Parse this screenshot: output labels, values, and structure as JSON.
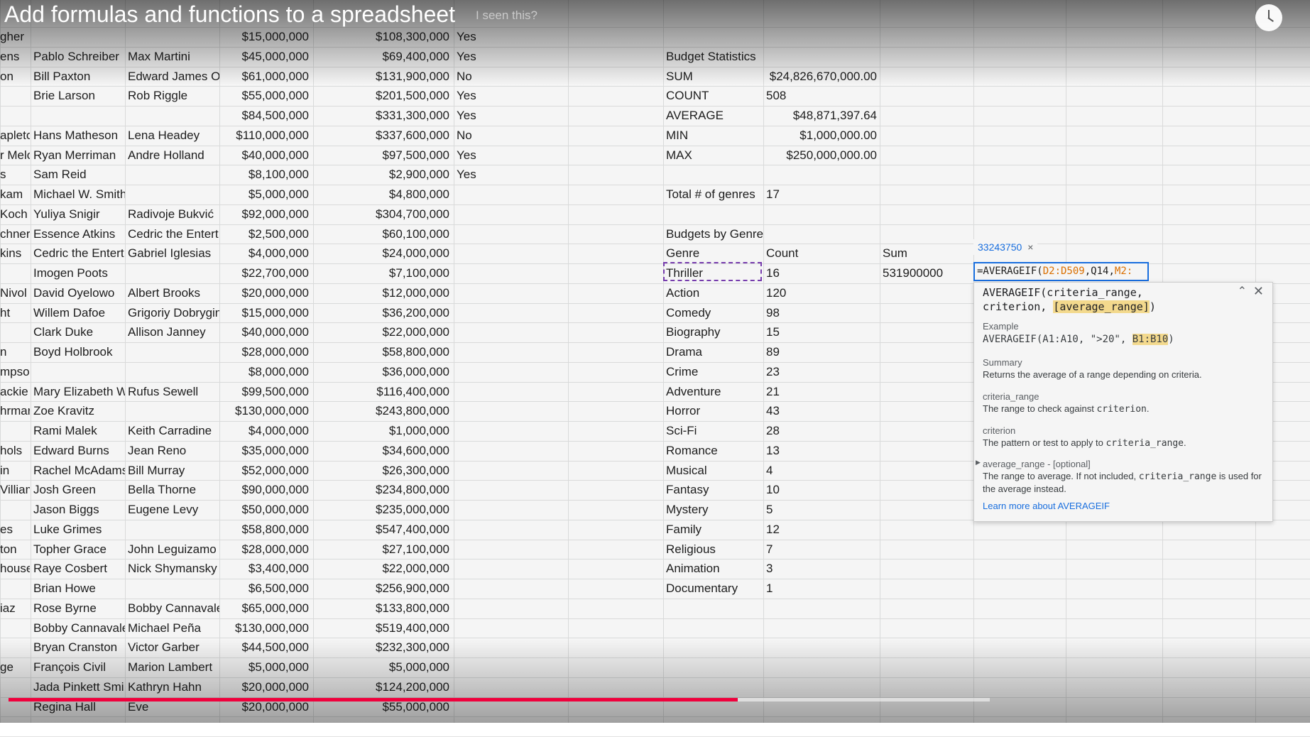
{
  "video": {
    "title": "Add formulas and functions to a spreadsheet",
    "faint_text": "I seen this?"
  },
  "rows": [
    {
      "a": "gher",
      "b": "",
      "c": "",
      "d": "$15,000,000",
      "e": "$108,300,000",
      "f": "Yes"
    },
    {
      "a": "ens",
      "b": "Pablo Schreiber",
      "c": "Max Martini",
      "d": "$45,000,000",
      "e": "$69,400,000",
      "f": "Yes"
    },
    {
      "a": "on",
      "b": "Bill Paxton",
      "c": "Edward James O",
      "d": "$61,000,000",
      "e": "$131,900,000",
      "f": "No"
    },
    {
      "a": "",
      "b": "Brie Larson",
      "c": "Rob Riggle",
      "d": "$55,000,000",
      "e": "$201,500,000",
      "f": "Yes"
    },
    {
      "a": "",
      "b": "",
      "c": "",
      "d": "$84,500,000",
      "e": "$331,300,000",
      "f": "Yes"
    },
    {
      "a": "apleto",
      "b": "Hans Matheson",
      "c": "Lena Headey",
      "d": "$110,000,000",
      "e": "$337,600,000",
      "f": "No"
    },
    {
      "a": "r Melo",
      "b": "Ryan Merriman",
      "c": "Andre Holland",
      "d": "$40,000,000",
      "e": "$97,500,000",
      "f": "Yes"
    },
    {
      "a": "s",
      "b": "Sam Reid",
      "c": "",
      "d": "$8,100,000",
      "e": "$2,900,000",
      "f": "Yes"
    },
    {
      "a": "kam",
      "b": "Michael W. Smith",
      "c": "",
      "d": "$5,000,000",
      "e": "$4,800,000",
      "f": ""
    },
    {
      "a": "Koch",
      "b": "Yuliya Snigir",
      "c": "Radivoje Bukvić",
      "d": "$92,000,000",
      "e": "$304,700,000",
      "f": ""
    },
    {
      "a": "chner",
      "b": "Essence Atkins",
      "c": "Cedric the Entert",
      "d": "$2,500,000",
      "e": "$60,100,000",
      "f": ""
    },
    {
      "a": "kins",
      "b": "Cedric the Entert",
      "c": "Gabriel Iglesias",
      "d": "$4,000,000",
      "e": "$24,000,000",
      "f": ""
    },
    {
      "a": "",
      "b": "Imogen Poots",
      "c": "",
      "d": "$22,700,000",
      "e": "$7,100,000",
      "f": ""
    },
    {
      "a": "Nivol",
      "b": "David Oyelowo",
      "c": "Albert Brooks",
      "d": "$20,000,000",
      "e": "$12,000,000",
      "f": ""
    },
    {
      "a": "ht",
      "b": "Willem Dafoe",
      "c": "Grigoriy Dobrygin",
      "d": "$15,000,000",
      "e": "$36,200,000",
      "f": ""
    },
    {
      "a": "",
      "b": "Clark Duke",
      "c": "Allison Janney",
      "d": "$40,000,000",
      "e": "$22,000,000",
      "f": ""
    },
    {
      "a": "n",
      "b": "Boyd Holbrook",
      "c": "",
      "d": "$28,000,000",
      "e": "$58,800,000",
      "f": ""
    },
    {
      "a": "mpson",
      "b": "",
      "c": "",
      "d": "$8,000,000",
      "e": "$36,000,000",
      "f": ""
    },
    {
      "a": "ackie",
      "b": "Mary Elizabeth W",
      "c": "Rufus Sewell",
      "d": "$99,500,000",
      "e": "$116,400,000",
      "f": ""
    },
    {
      "a": "hrmar",
      "b": "Zoe Kravitz",
      "c": "",
      "d": "$130,000,000",
      "e": "$243,800,000",
      "f": ""
    },
    {
      "a": "",
      "b": "Rami Malek",
      "c": "Keith Carradine",
      "d": "$4,000,000",
      "e": "$1,000,000",
      "f": ""
    },
    {
      "a": "hols",
      "b": "Edward Burns",
      "c": "Jean Reno",
      "d": "$35,000,000",
      "e": "$34,600,000",
      "f": ""
    },
    {
      "a": "in",
      "b": "Rachel McAdams",
      "c": "Bill Murray",
      "d": "$52,000,000",
      "e": "$26,300,000",
      "f": ""
    },
    {
      "a": "Villiams",
      "b": "Josh Green",
      "c": "Bella Thorne",
      "d": "$90,000,000",
      "e": "$234,800,000",
      "f": ""
    },
    {
      "a": "",
      "b": "Jason Biggs",
      "c": "Eugene Levy",
      "d": "$50,000,000",
      "e": "$235,000,000",
      "f": ""
    },
    {
      "a": "es",
      "b": "Luke Grimes",
      "c": "",
      "d": "$58,800,000",
      "e": "$547,400,000",
      "f": ""
    },
    {
      "a": "ton",
      "b": "Topher Grace",
      "c": "John Leguizamo",
      "d": "$28,000,000",
      "e": "$27,100,000",
      "f": ""
    },
    {
      "a": "house",
      "b": "Raye Cosbert",
      "c": "Nick Shymansky",
      "d": "$3,400,000",
      "e": "$22,000,000",
      "f": ""
    },
    {
      "a": "",
      "b": "Brian Howe",
      "c": "",
      "d": "$6,500,000",
      "e": "$256,900,000",
      "f": ""
    },
    {
      "a": "iaz",
      "b": "Rose Byrne",
      "c": "Bobby Cannavale",
      "d": "$65,000,000",
      "e": "$133,800,000",
      "f": ""
    },
    {
      "a": "",
      "b": "Bobby Cannavale",
      "c": "Michael Peña",
      "d": "$130,000,000",
      "e": "$519,400,000",
      "f": ""
    },
    {
      "a": "",
      "b": "Bryan Cranston",
      "c": "Victor Garber",
      "d": "$44,500,000",
      "e": "$232,300,000",
      "f": ""
    },
    {
      "a": "ge",
      "b": "François Civil",
      "c": "Marion Lambert",
      "d": "$5,000,000",
      "e": "$5,000,000",
      "f": ""
    },
    {
      "a": "",
      "b": "Jada Pinkett Smi",
      "c": "Kathryn Hahn",
      "d": "$20,000,000",
      "e": "$124,200,000",
      "f": ""
    },
    {
      "a": "",
      "b": "Regina Hall",
      "c": "Eve",
      "d": "$20,000,000",
      "e": "$55,000,000",
      "f": ""
    }
  ],
  "stats": {
    "header": "Budget Statistics",
    "items": [
      {
        "label": "SUM",
        "value": "$24,826,670,000.00"
      },
      {
        "label": "COUNT",
        "value": "508"
      },
      {
        "label": "AVERAGE",
        "value": "$48,871,397.64"
      },
      {
        "label": "MIN",
        "value": "$1,000,000.00"
      },
      {
        "label": "MAX",
        "value": "$250,000,000.00"
      }
    ],
    "genres_label": "Total # of genres",
    "genres_value": "17"
  },
  "genre_table": {
    "title": "Budgets by Genre",
    "col_genre": "Genre",
    "col_count": "Count",
    "col_sum": "Sum",
    "sum_value": "531900000",
    "rows": [
      {
        "genre": "Thriller",
        "count": "16"
      },
      {
        "genre": "Action",
        "count": "120"
      },
      {
        "genre": "Comedy",
        "count": "98"
      },
      {
        "genre": "Biography",
        "count": "15"
      },
      {
        "genre": "Drama",
        "count": "89"
      },
      {
        "genre": "Crime",
        "count": "23"
      },
      {
        "genre": "Adventure",
        "count": "21"
      },
      {
        "genre": "Horror",
        "count": "43"
      },
      {
        "genre": "Sci-Fi",
        "count": "28"
      },
      {
        "genre": "Romance",
        "count": "13"
      },
      {
        "genre": "Musical",
        "count": "4"
      },
      {
        "genre": "Fantasy",
        "count": "10"
      },
      {
        "genre": "Mystery",
        "count": "5"
      },
      {
        "genre": "Family",
        "count": "12"
      },
      {
        "genre": "Religious",
        "count": "7"
      },
      {
        "genre": "Animation",
        "count": "3"
      },
      {
        "genre": "Documentary",
        "count": "1"
      }
    ]
  },
  "formula": {
    "chip": "33243750",
    "chip_close": "×",
    "prefix": "=AVERAGEIF(",
    "arg1": "D2:D509",
    "mid": ",Q14,",
    "arg3": "M2:"
  },
  "tooltip": {
    "signature_main": "AVERAGEIF(criteria_range, criterion,",
    "signature_opt": "[average_range]",
    "signature_end": ")",
    "close": "✕",
    "collapse": "⌃",
    "example_label": "Example",
    "example_main": "AVERAGEIF(A1:A10, \">20\", ",
    "example_hl": "B1:B10",
    "example_end": ")",
    "summary_label": "Summary",
    "summary_text": "Returns the average of a range depending on criteria.",
    "p1_label": "criteria_range",
    "p1_text": "The range to check against ",
    "p1_code": "criterion",
    "p1_end": ".",
    "p2_label": "criterion",
    "p2_text": "The pattern or test to apply to ",
    "p2_code": "criteria_range",
    "p2_end": ".",
    "p3_label": "average_range - [optional]",
    "p3_text1": "The range to average. If not included, ",
    "p3_code": "criteria_range",
    "p3_text2": " is used for the average instead.",
    "link": "Learn more about AVERAGEIF"
  },
  "colors": {
    "progress": "#f0003c",
    "selection_border": "#1a73e8",
    "copy_border": "#7b3fb5",
    "link": "#1a73e8"
  }
}
